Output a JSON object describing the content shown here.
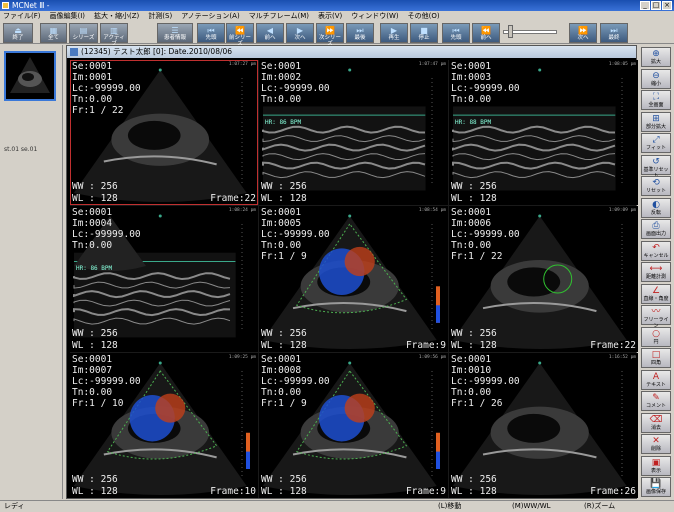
{
  "window": {
    "title": "MCNet Ⅲ -"
  },
  "menu": [
    "ファイル(F)",
    "画像編集(I)",
    "拡大・縮小(Z)",
    "計測(S)",
    "アノテーション(A)",
    "マルチフレーム(M)",
    "表示(V)",
    "ウィンドウ(W)",
    "その他(O)"
  ],
  "toolbar": {
    "end": "終了",
    "full": "全て",
    "series": "シリーズ",
    "active": "アクティブ",
    "patient_info": "患者情報",
    "first": "先頭",
    "prev_series": "前シリーズ",
    "prev": "前へ",
    "next": "次へ",
    "next_series": "次シリーズ",
    "last": "最後",
    "play": "再生",
    "stop": "停止",
    "frame_first": "先頭",
    "frame_prev": "前へ",
    "frame_next": "次へ",
    "frame_last": "最終"
  },
  "thumbnail": {
    "label": "st.01  se.01"
  },
  "viewer": {
    "title": "(12345) テスト太郎 [0]: Date.2010/08/06"
  },
  "cells": [
    {
      "se": "Se:0001",
      "im": "Im:0001",
      "lc": "Lc:-99999.00",
      "tn": "Tn:0.00",
      "fr": "Fr:1 / 22",
      "ww": "WW : 256",
      "wl": "WL : 128",
      "frame": "Frame:22",
      "time": "1:07:27 pm",
      "hr": ""
    },
    {
      "se": "Se:0001",
      "im": "Im:0002",
      "lc": "Lc:-99999.00",
      "tn": "Tn:0.00",
      "fr": "",
      "ww": "WW : 256",
      "wl": "WL : 128",
      "frame": "",
      "time": "1:07:47 pm",
      "hr": "HR: 86 BPM"
    },
    {
      "se": "Se:0001",
      "im": "Im:0003",
      "lc": "Lc:-99999.00",
      "tn": "Tn:0.00",
      "fr": "",
      "ww": "WW : 256",
      "wl": "WL : 128",
      "frame": "",
      "time": "1:08:05 pm",
      "hr": "HR: 88 BPM"
    },
    {
      "se": "Se:0001",
      "im": "Im:0004",
      "lc": "Lc:-99999.00",
      "tn": "Tn:0.00",
      "fr": "",
      "ww": "WW : 256",
      "wl": "WL : 128",
      "frame": "",
      "time": "1:08:24 pm",
      "hr": "HR: 86 BPM"
    },
    {
      "se": "Se:0001",
      "im": "Im:0005",
      "lc": "Lc:-99999.00",
      "tn": "Tn:0.00",
      "fr": "Fr:1 / 9",
      "ww": "WW : 256",
      "wl": "WL : 128",
      "frame": "Frame:9",
      "time": "1:08:54 pm",
      "hr": ""
    },
    {
      "se": "Se:0001",
      "im": "Im:0006",
      "lc": "Lc:-99999.00",
      "tn": "Tn:0.00",
      "fr": "Fr:1 / 22",
      "ww": "WW : 256",
      "wl": "WL : 128",
      "frame": "Frame:22",
      "time": "1:09:09 pm",
      "hr": ""
    },
    {
      "se": "Se:0001",
      "im": "Im:0007",
      "lc": "Lc:-99999.00",
      "tn": "Tn:0.00",
      "fr": "Fr:1 / 10",
      "ww": "WW : 256",
      "wl": "WL : 128",
      "frame": "Frame:10",
      "time": "1:09:25 pm",
      "hr": ""
    },
    {
      "se": "Se:0001",
      "im": "Im:0008",
      "lc": "Lc:-99999.00",
      "tn": "Tn:0.00",
      "fr": "Fr:1 / 9",
      "ww": "WW : 256",
      "wl": "WL : 128",
      "frame": "Frame:9",
      "time": "1:09:56 pm",
      "hr": ""
    },
    {
      "se": "Se:0001",
      "im": "Im:0010",
      "lc": "Lc:-99999.00",
      "tn": "Tn:0.00",
      "fr": "Fr:1 / 26",
      "ww": "WW : 256",
      "wl": "WL : 128",
      "frame": "Frame:26",
      "time": "1:16:52 pm",
      "hr": ""
    }
  ],
  "sidebar": [
    "拡大",
    "縮小",
    "全画面",
    "部分拡大",
    "フィット",
    "基準リセット",
    "リセット",
    "反転",
    "画面出力",
    "キャンセル",
    "距離計測",
    "直線・角度",
    "フリーライン",
    "円",
    "四角",
    "テキスト",
    "コメント",
    "消去",
    "削除",
    "表示",
    "画像保存"
  ],
  "status": {
    "ready": "レディ",
    "l": "(L)移動",
    "m": "(M)WW/WL",
    "r": "(R)ズーム"
  }
}
